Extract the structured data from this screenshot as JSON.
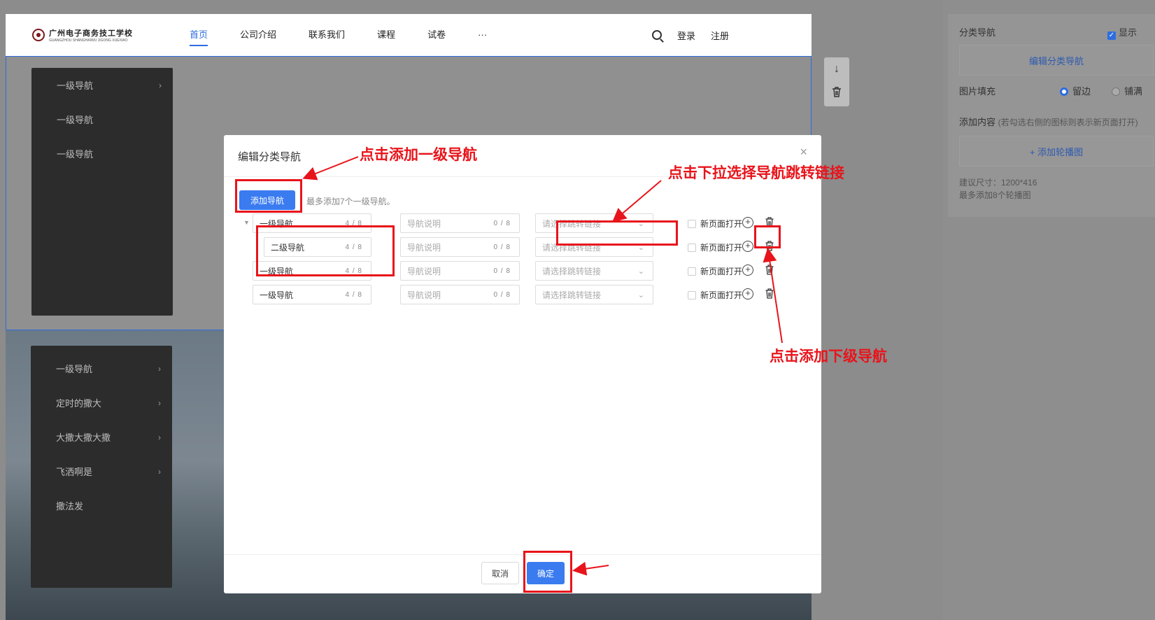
{
  "site": {
    "logo_text": "广州电子商务技工学校",
    "logo_sub": "GUANGZHOU SHANGHAIWU JIGONG XUEXIAO",
    "menu": [
      "首页",
      "公司介绍",
      "联系我们",
      "课程",
      "试卷",
      "···"
    ],
    "nav_right": {
      "login": "登录",
      "register": "注册"
    }
  },
  "backdrop": {
    "panel1_items": [
      {
        "label": "一级导航",
        "chevron": true
      },
      {
        "label": "一级导航",
        "chevron": false
      },
      {
        "label": "一级导航",
        "chevron": false
      }
    ],
    "panel2_items": [
      {
        "label": "一级导航",
        "chevron": true
      },
      {
        "label": "定时的撒大",
        "chevron": true
      },
      {
        "label": "大撒大撒大撒",
        "chevron": true
      },
      {
        "label": "飞洒啊是",
        "chevron": true
      },
      {
        "label": "撒法发",
        "chevron": false
      }
    ]
  },
  "right_panel": {
    "section_label": "分类导航",
    "show_label": "显示",
    "edit_button": "编辑分类导航",
    "fill_label": "图片填充",
    "fill_options": [
      "留边",
      "铺满"
    ],
    "fill_selected": "留边",
    "add_content_label": "添加内容",
    "add_content_hint": "(若勾选右侧的图标则表示新页面打开)",
    "add_banner_button": "+ 添加轮播图",
    "size_hint": "建议尺寸：1200*416",
    "max_hint": "最多添加8个轮播图"
  },
  "modal": {
    "title": "编辑分类导航",
    "close": "×",
    "add_button": "添加导航",
    "add_hint": "最多添加7个一级导航。",
    "rows": [
      {
        "name": "一级导航",
        "name_count": "4 / 8",
        "desc_placeholder": "导航说明",
        "desc_count": "0 / 8",
        "link_placeholder": "请选择跳转链接",
        "new_page": "新页面打开",
        "level": 1,
        "expanded": true
      },
      {
        "name": "二级导航",
        "name_count": "4 / 8",
        "desc_placeholder": "导航说明",
        "desc_count": "0 / 8",
        "link_placeholder": "请选择跳转链接",
        "new_page": "新页面打开",
        "level": 2,
        "expanded": false
      },
      {
        "name": "一级导航",
        "name_count": "4 / 8",
        "desc_placeholder": "导航说明",
        "desc_count": "0 / 8",
        "link_placeholder": "请选择跳转链接",
        "new_page": "新页面打开",
        "level": 1,
        "expanded": false
      },
      {
        "name": "一级导航",
        "name_count": "4 / 8",
        "desc_placeholder": "导航说明",
        "desc_count": "0 / 8",
        "link_placeholder": "请选择跳转链接",
        "new_page": "新页面打开",
        "level": 1,
        "expanded": false
      }
    ],
    "cancel": "取消",
    "ok": "确定"
  },
  "annotations": {
    "add_top_nav": "点击添加一级导航",
    "select_link": "点击下拉选择导航跳转链接",
    "add_sub_nav": "点击添加下级导航",
    "color": "#e8141b"
  },
  "colors": {
    "primary": "#3a7bf0",
    "annotation": "#e8141b"
  }
}
